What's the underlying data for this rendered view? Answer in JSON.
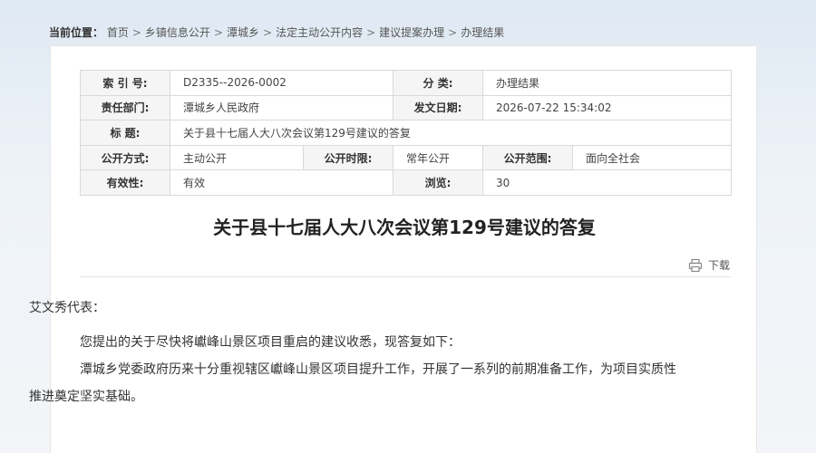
{
  "breadcrumb": {
    "label": "当前位置：",
    "items": [
      "首页",
      "乡镇信息公开",
      "潭城乡",
      "法定主动公开内容",
      "建议提案办理",
      "办理结果"
    ],
    "separator": ">"
  },
  "meta": {
    "index_label": "索 引 号:",
    "index_value": "D2335--2026-0002",
    "category_label": "分    类:",
    "category_value": "办理结果",
    "dept_label": "责任部门:",
    "dept_value": "潭城乡人民政府",
    "date_label": "发文日期:",
    "date_value": "2026-07-22 15:34:02",
    "title_label": "标    题:",
    "title_value": "关于县十七届人大八次会议第129号建议的答复",
    "method_label": "公开方式:",
    "method_value": "主动公开",
    "period_label": "公开时限:",
    "period_value": "常年公开",
    "scope_label": "公开范围:",
    "scope_value": "面向全社会",
    "validity_label": "有效性:",
    "validity_value": "有效",
    "views_label": "浏览:",
    "views_value": "30"
  },
  "article": {
    "title": "关于县十七届人大八次会议第129号建议的答复",
    "download_label": "下载",
    "greeting": "艾文秀代表：",
    "paragraphs": [
      "您提出的关于尽快将巘峰山景区项目重启的建议收悉，现答复如下：",
      "潭城乡党委政府历来十分重视辖区巘峰山景区项目提升工作，开展了一系列的前期准备工作，为项目实质性推进奠定坚实基础。"
    ]
  },
  "colors": {
    "label_bg": "#f5f5f5",
    "border": "#d9d9d9"
  }
}
